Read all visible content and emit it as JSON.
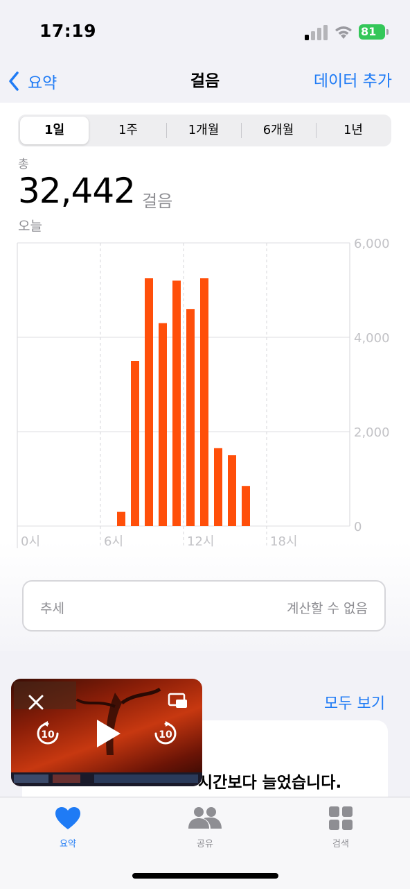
{
  "status_bar": {
    "time": "17:19",
    "battery": "81"
  },
  "nav": {
    "back_label": "요약",
    "title": "걸음",
    "add_label": "데이터 추가"
  },
  "segments": [
    "1일",
    "1주",
    "1개월",
    "6개월",
    "1년"
  ],
  "summary": {
    "total_label": "총",
    "total_value": "32,442",
    "unit": "걸음",
    "date_label": "오늘"
  },
  "chart_data": {
    "type": "bar",
    "x_tick_labels": [
      "0시",
      "6시",
      "12시",
      "18시"
    ],
    "y_tick_labels": [
      "6,000",
      "4,000",
      "2,000",
      "0"
    ],
    "ylim": [
      0,
      6000
    ],
    "hours": [
      7,
      8,
      9,
      10,
      11,
      12,
      13,
      14,
      15,
      16
    ],
    "values": [
      300,
      3500,
      5250,
      4300,
      5200,
      4600,
      5250,
      1650,
      1500,
      850
    ],
    "bar_color": "#ff4f0a"
  },
  "trend": {
    "label": "추세",
    "value": "계산할 수 없음"
  },
  "highlights": {
    "see_all_label": "모두 보기",
    "text": "시간보다 늘었습니다."
  },
  "tab_bar": {
    "items": [
      "요약",
      "공유",
      "검색"
    ]
  },
  "colors": {
    "accent": "#1f7bf5",
    "bars": "#ff4f0a"
  }
}
